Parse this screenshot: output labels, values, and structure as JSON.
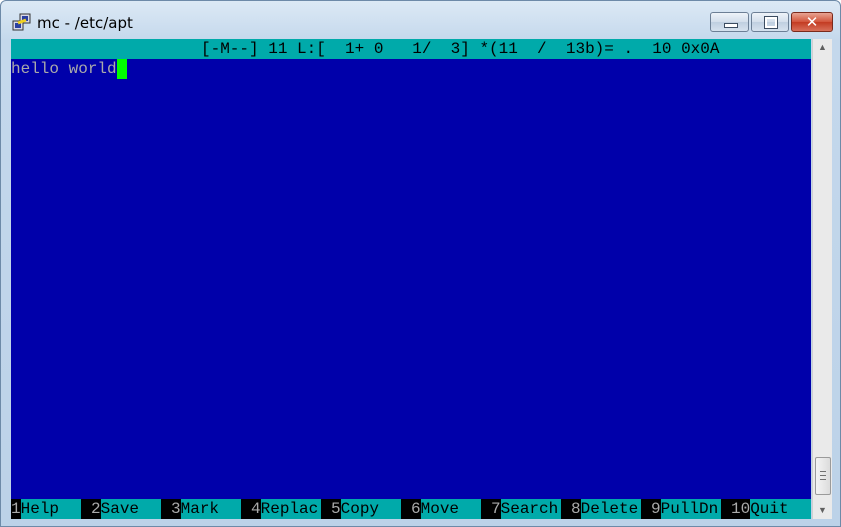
{
  "window": {
    "title": "mc - /etc/apt",
    "app_icon": "putty-terminal-icon",
    "controls": {
      "minimize": "minimize-icon",
      "maximize": "maximize-icon",
      "close": "close-icon",
      "close_glyph": "✕"
    }
  },
  "editor": {
    "status_line": "[-M--] 11 L:[  1+ 0   1/  3] *(11  /  13b)= .  10 0x0A",
    "content_lines": [
      "hello world"
    ],
    "colors": {
      "background": "#0000aa",
      "status_bar": "#00aaaa",
      "cursor": "#00ff00",
      "text": "#aaaaaa"
    }
  },
  "function_keys": [
    {
      "num": "1",
      "label": "Help"
    },
    {
      "num": "2",
      "label": "Save"
    },
    {
      "num": "3",
      "label": "Mark"
    },
    {
      "num": "4",
      "label": "Replac"
    },
    {
      "num": "5",
      "label": "Copy"
    },
    {
      "num": "6",
      "label": "Move"
    },
    {
      "num": "7",
      "label": "Search"
    },
    {
      "num": "8",
      "label": "Delete"
    },
    {
      "num": "9",
      "label": "PullDn"
    },
    {
      "num": "10",
      "label": "Quit"
    }
  ],
  "scrollbar": {
    "up_glyph": "▲",
    "down_glyph": "▼"
  }
}
